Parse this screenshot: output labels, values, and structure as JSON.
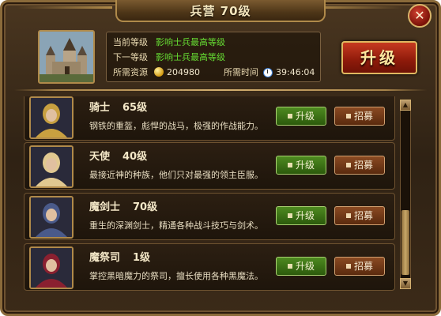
{
  "window": {
    "title": "兵营 70级",
    "close_label": "✕"
  },
  "info": {
    "current_level_label": "当前等级",
    "current_level_value": "影响士兵最高等级",
    "next_level_label": "下一等级",
    "next_level_value": "影响士兵最高等级",
    "resource_label": "所需资源",
    "resource_value": "204980",
    "time_label": "所需时间",
    "time_value": "39:46:04",
    "resource_icon": "gold-coin-icon",
    "time_icon": "clock-icon"
  },
  "upgrade_button": {
    "label": "升级"
  },
  "units": [
    {
      "name": "骑士",
      "level": "65级",
      "desc": "钢铁的重盔，彪悍的战马，极强的作战能力。",
      "upgrade_label": "升级",
      "recruit_label": "招募",
      "portrait_color": "#c8a040"
    },
    {
      "name": "天使",
      "level": "40级",
      "desc": "最接近神的种族，他们只对最强的领主臣服。",
      "upgrade_label": "升级",
      "recruit_label": "招募",
      "portrait_color": "#e0c890"
    },
    {
      "name": "魔剑士",
      "level": "70级",
      "desc": "重生的深渊剑士，精通各种战斗技巧与剑术。",
      "upgrade_label": "升级",
      "recruit_label": "招募",
      "portrait_color": "#4a5a8a"
    },
    {
      "name": "魔祭司",
      "level": "1级",
      "desc": "掌控黑暗魔力的祭司，擅长使用各种黑魔法。",
      "upgrade_label": "升级",
      "recruit_label": "招募",
      "portrait_color": "#8a2030"
    }
  ],
  "colors": {
    "green_text": "#66dd33",
    "upgrade_red": "#c63a20",
    "gold_border": "#b08a4a"
  }
}
